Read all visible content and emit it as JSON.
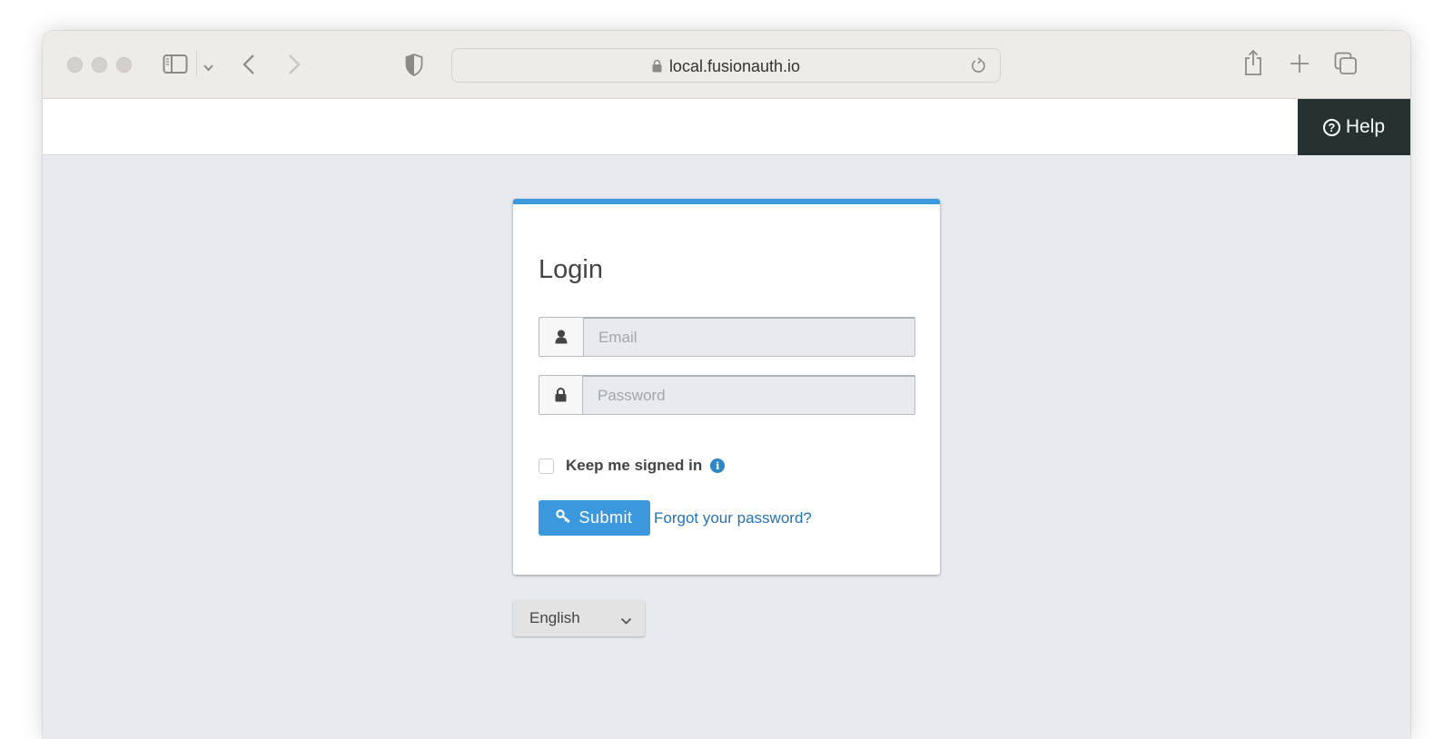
{
  "browser": {
    "url": "local.fusionauth.io",
    "icons": {
      "sidebar": "sidebar-icon",
      "back": "chevron-left-icon",
      "forward": "chevron-right-icon",
      "privacy": "shield-icon",
      "lock": "lock-icon",
      "reload": "reload-icon",
      "share": "share-icon",
      "new_tab": "plus-icon",
      "tabs": "tab-overview-icon"
    }
  },
  "header": {
    "help_label": "Help",
    "help_icon": "?"
  },
  "login": {
    "title": "Login",
    "email_placeholder": "Email",
    "password_placeholder": "Password",
    "keep_signed_in_label": "Keep me signed in",
    "keep_signed_in_checked": false,
    "info_icon": "i",
    "submit_label": "Submit",
    "forgot_label": "Forgot your password?",
    "accent_color": "#3c98dc"
  },
  "locale": {
    "selected": "English"
  }
}
